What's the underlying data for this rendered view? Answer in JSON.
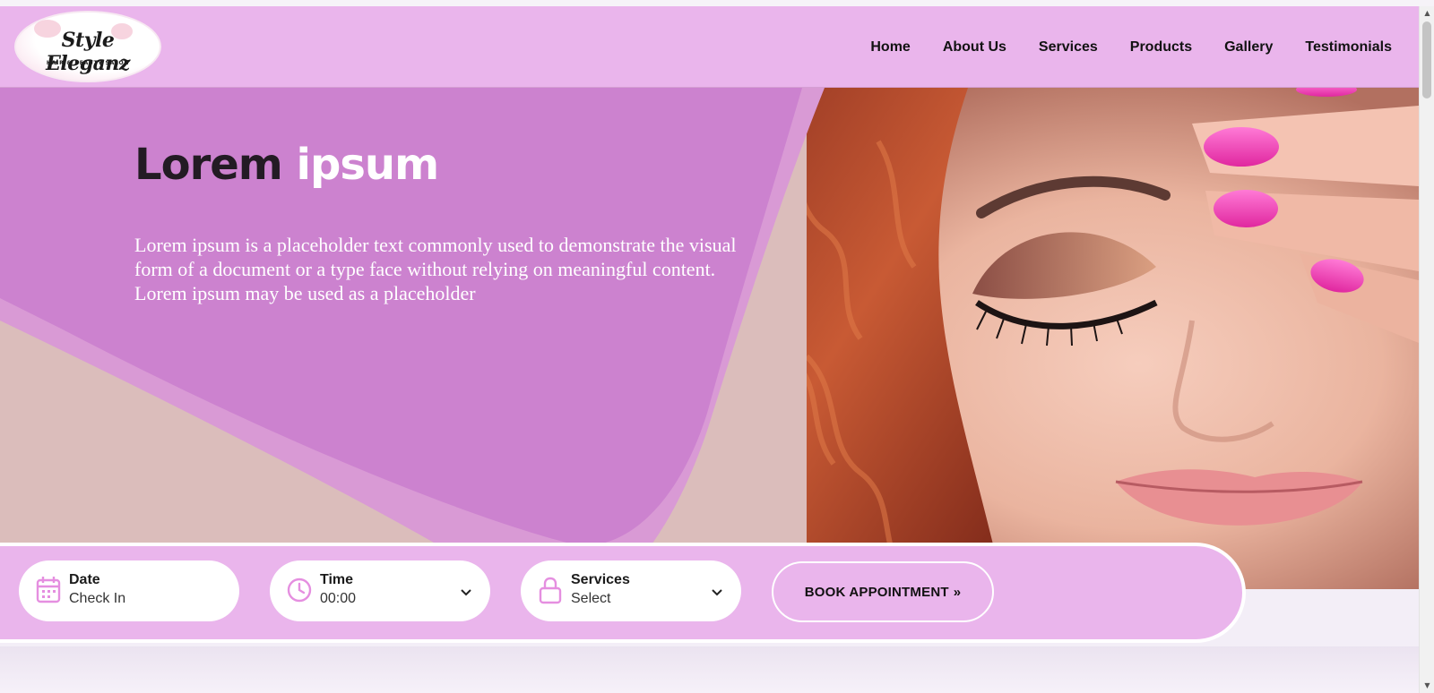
{
  "brand": {
    "logo_script": "Style Eleganz",
    "logo_tagline": "HAIR & BEAUTY SALON"
  },
  "nav": {
    "items": [
      {
        "label": "Home"
      },
      {
        "label": "About Us"
      },
      {
        "label": "Services"
      },
      {
        "label": "Products"
      },
      {
        "label": "Gallery"
      },
      {
        "label": "Testimonials"
      }
    ]
  },
  "hero": {
    "title_dark": "Lorem",
    "title_light": "ipsum",
    "description": "Lorem ipsum is a placeholder text commonly used to demonstrate the visual form of a document or a type face without relying on meaningful content. Lorem ipsum may be used as a placeholder",
    "image": "woman-with-pink-nails-and-red-curly-hair"
  },
  "booking": {
    "date": {
      "label": "Date",
      "value": "Check In",
      "icon": "calendar-icon"
    },
    "time": {
      "label": "Time",
      "value": "00:00",
      "icon": "clock-icon"
    },
    "services": {
      "label": "Services",
      "value": "Select",
      "icon": "lock-icon"
    },
    "button_label": "BOOK APPOINTMENT",
    "button_icon": "double-chevron-right-icon"
  },
  "colors": {
    "header": "#eab5ec",
    "hero_purple": "#cc82cf",
    "hero_beige": "#dbbdbb",
    "nail_pink": "#f03ab4",
    "icon_pink": "#e58fe0"
  }
}
